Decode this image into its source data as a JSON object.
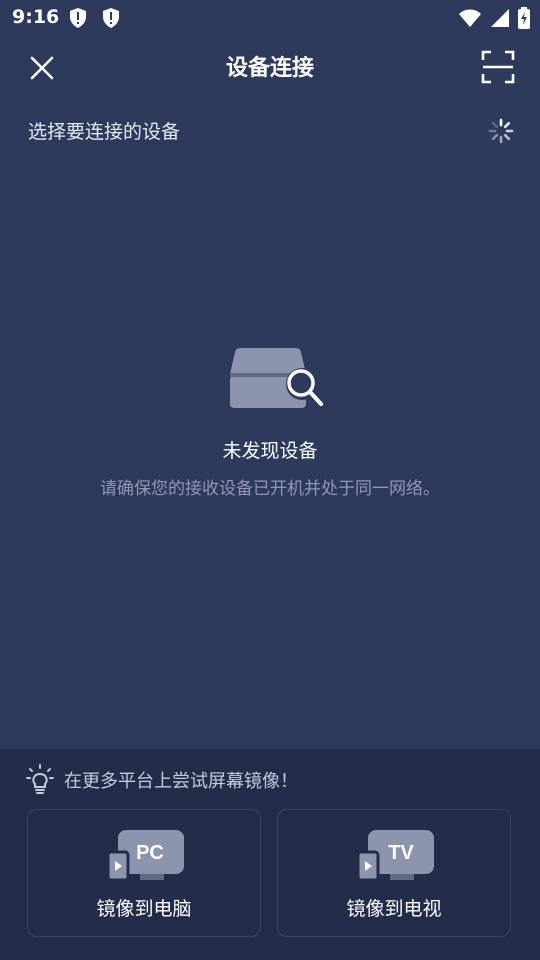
{
  "status_bar": {
    "time": "9:16"
  },
  "header": {
    "title": "设备连接"
  },
  "section": {
    "label": "选择要连接的设备"
  },
  "empty_state": {
    "title": "未发现设备",
    "description": "请确保您的接收设备已开机并处于同一网络。"
  },
  "tip": {
    "text": "在更多平台上尝试屏幕镜像！"
  },
  "mirror_options": [
    {
      "badge": "PC",
      "label": "镜像到电脑"
    },
    {
      "badge": "TV",
      "label": "镜像到电视"
    }
  ],
  "colors": {
    "background": "#2d3a5c",
    "panel": "#232d4a",
    "muted_text": "#8f99b3"
  },
  "icons": {
    "close": "close-icon",
    "scan": "scan-icon",
    "spinner": "loading-spinner-icon",
    "bulb": "lightbulb-icon"
  }
}
